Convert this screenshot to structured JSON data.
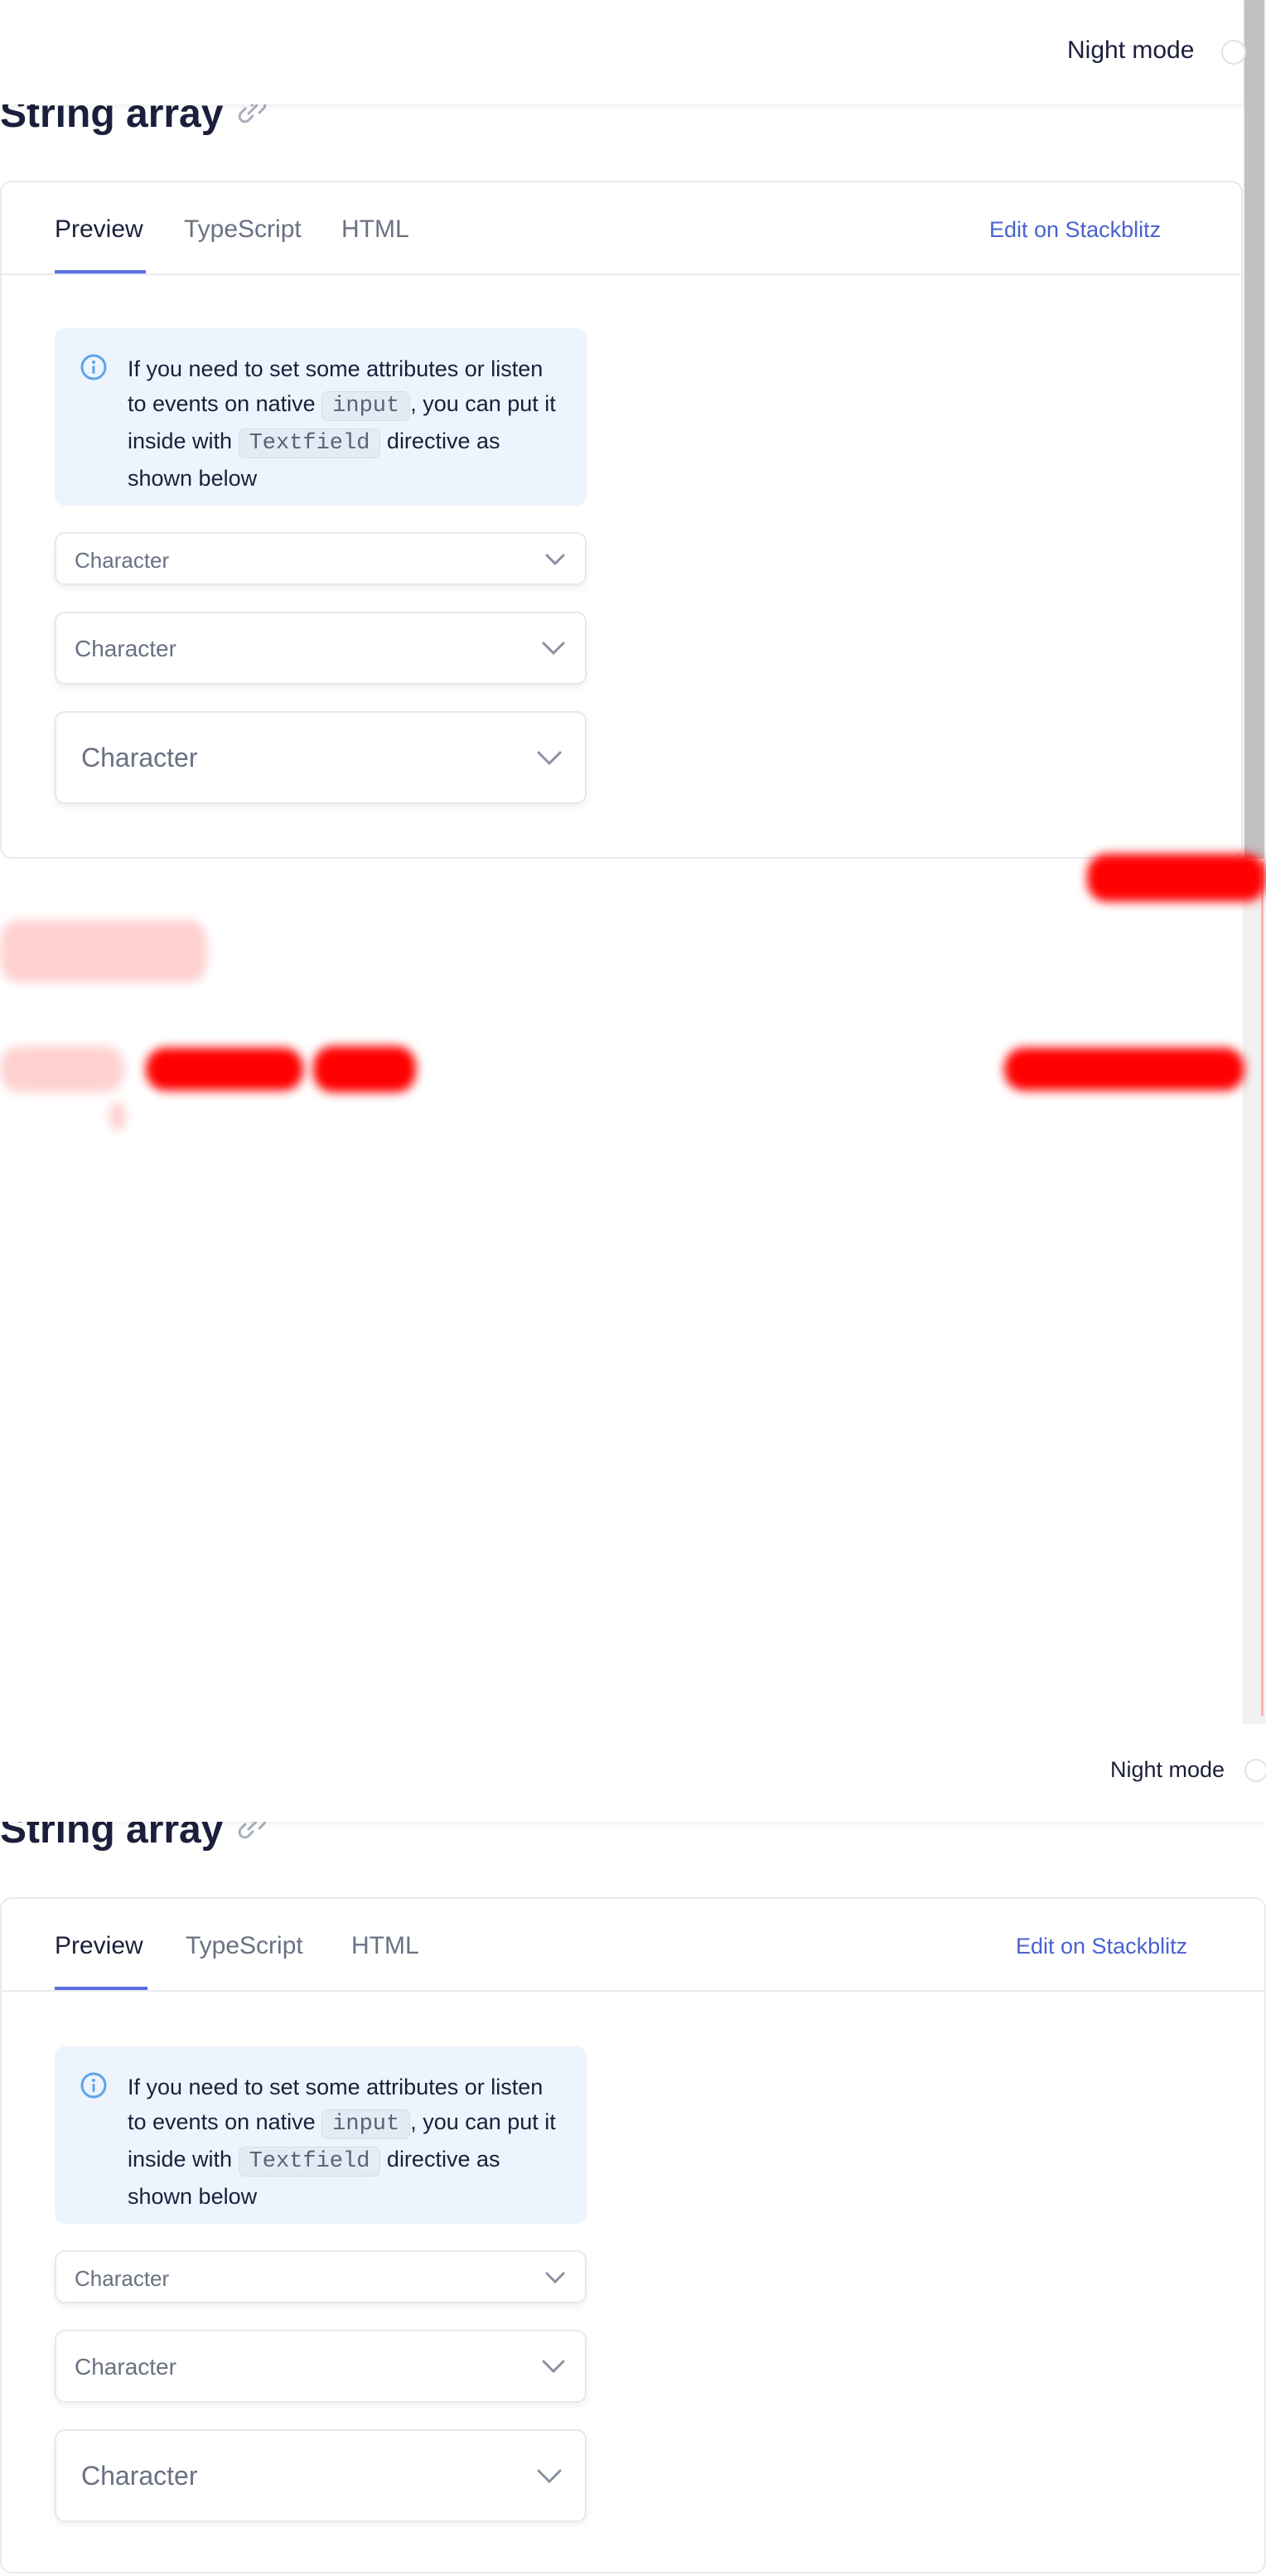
{
  "header": {
    "night_mode_label": "Night mode"
  },
  "page": {
    "title": "String array"
  },
  "demo": {
    "tabs": [
      {
        "label": "Preview",
        "active": true
      },
      {
        "label": "TypeScript",
        "active": false
      },
      {
        "label": "HTML",
        "active": false
      }
    ],
    "stackblitz_label": "Edit on Stackblitz",
    "notification": {
      "text_before_input": "If you need to set some attributes or listen to events on native",
      "code_input": "input",
      "text_middle": ", you can put it inside with",
      "code_textfield": "Textfield",
      "text_after": "directive as shown below"
    },
    "selects": [
      {
        "size": "s",
        "placeholder": "Character"
      },
      {
        "size": "m",
        "placeholder": "Character"
      },
      {
        "size": "l",
        "placeholder": "Character"
      }
    ]
  },
  "icons": {
    "link": "link-icon",
    "info": "info-icon",
    "chevron": "chevron-down-icon"
  },
  "colors": {
    "accent": "#5b6ee0",
    "link": "#4a62d0",
    "info_bg": "#edf4fd",
    "info_icon": "#5fa4e8",
    "redaction": "#ff0000"
  }
}
